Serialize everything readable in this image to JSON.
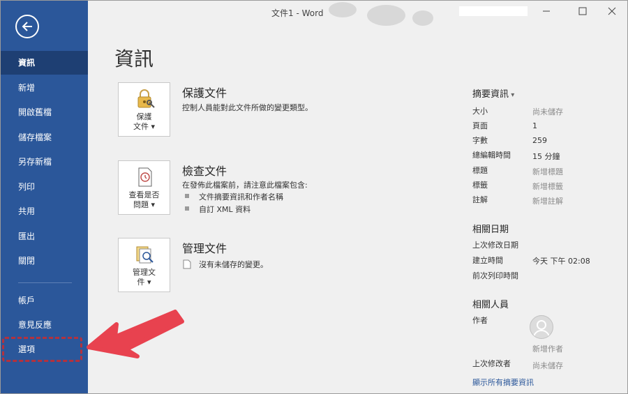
{
  "titlebar": {
    "title": "文件1 - Word"
  },
  "sidebar": {
    "items": [
      {
        "label": "資訊"
      },
      {
        "label": "新增"
      },
      {
        "label": "開啟舊檔"
      },
      {
        "label": "儲存檔案"
      },
      {
        "label": "另存新檔"
      },
      {
        "label": "列印"
      },
      {
        "label": "共用"
      },
      {
        "label": "匯出"
      },
      {
        "label": "關閉"
      },
      {
        "label": "帳戶"
      },
      {
        "label": "意見反應"
      },
      {
        "label": "選項"
      }
    ]
  },
  "main": {
    "title": "資訊",
    "protect": {
      "btn_line1": "保護",
      "btn_line2": "文件",
      "title": "保護文件",
      "desc": "控制人員能對此文件所做的變更類型。"
    },
    "inspect": {
      "btn_line1": "查看是否",
      "btn_line2": "問題",
      "title": "檢查文件",
      "desc": "在發佈此檔案前，請注意此檔案包含:",
      "bullets": [
        "文件摘要資訊和作者名稱",
        "自訂 XML 資料"
      ]
    },
    "manage": {
      "btn_line1": "管理文",
      "btn_line2": "件",
      "title": "管理文件",
      "desc": "沒有未儲存的變更。"
    }
  },
  "properties": {
    "header": "摘要資訊",
    "rows": [
      {
        "label": "大小",
        "value": "尚未儲存"
      },
      {
        "label": "頁面",
        "value": "1"
      },
      {
        "label": "字數",
        "value": "259"
      },
      {
        "label": "總編輯時間",
        "value": "15 分鐘"
      },
      {
        "label": "標題",
        "value": "新增標題"
      },
      {
        "label": "標籤",
        "value": "新增標籤"
      },
      {
        "label": "註解",
        "value": "新增註解"
      }
    ],
    "dates_header": "相關日期",
    "dates": [
      {
        "label": "上次修改日期",
        "value": ""
      },
      {
        "label": "建立時間",
        "value": "今天 下午 02:08"
      },
      {
        "label": "前次列印時間",
        "value": ""
      }
    ],
    "people_header": "相關人員",
    "author_label": "作者",
    "add_author": "新增作者",
    "last_modified_by_label": "上次修改者",
    "last_modified_by_value": "尚未儲存",
    "show_all": "顯示所有摘要資訊"
  },
  "colors": {
    "sidebar": "#2b579a",
    "sidebar_active": "#1e3f73",
    "annotation": "#e8424f"
  },
  "icons": [
    "back-arrow-icon",
    "minimize-icon",
    "maximize-icon",
    "close-icon",
    "lock-key-icon",
    "inspect-doc-icon",
    "manage-doc-icon",
    "doc-small-icon",
    "person-icon",
    "dropdown-caret-icon"
  ]
}
